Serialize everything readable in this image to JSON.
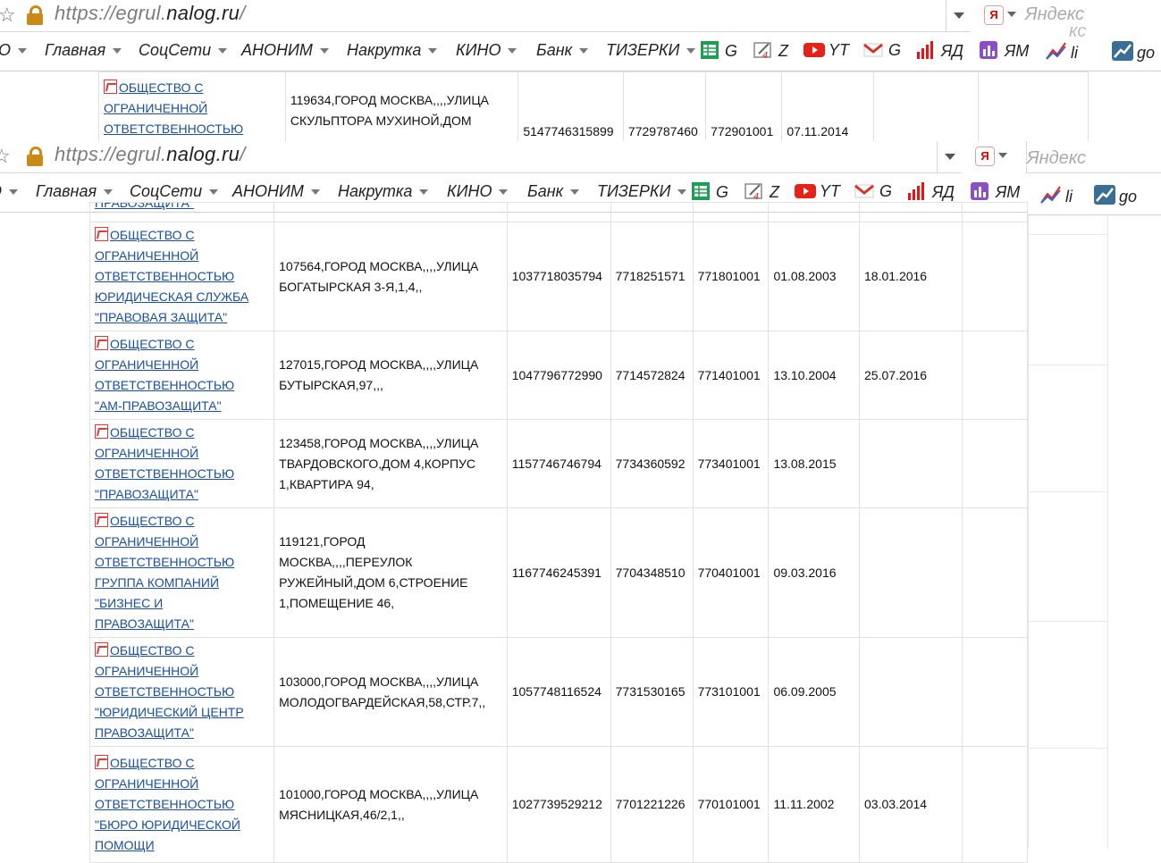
{
  "browser": {
    "url_prefix": "https://egrul.",
    "url_domain": "nalog.ru",
    "url_suffix": "/",
    "search_placeholder": "Яндекс",
    "search_partial_text": "кс"
  },
  "bookmarks": [
    {
      "label": "О",
      "dropdown": true
    },
    {
      "label": "Главная",
      "dropdown": true
    },
    {
      "label": "СоцСети",
      "dropdown": true
    },
    {
      "label": "АНОНИМ",
      "dropdown": true
    },
    {
      "label": "Накрутка",
      "dropdown": true
    },
    {
      "label": "КИНО",
      "dropdown": true
    },
    {
      "label": "Банк",
      "dropdown": true
    },
    {
      "label": "ТИЗЕРКИ",
      "dropdown": true
    },
    {
      "label": "G",
      "icon": "google-sheets-icon"
    },
    {
      "label": "Z",
      "icon": "edit-icon"
    },
    {
      "label": "YT",
      "icon": "youtube-icon"
    },
    {
      "label": "G",
      "icon": "gmail-icon"
    },
    {
      "label": "ЯД",
      "icon": "bar-chart-icon"
    },
    {
      "label": "ЯМ",
      "icon": "metrika-icon"
    },
    {
      "label": "li",
      "icon": "liveinternet-icon"
    },
    {
      "label": "go",
      "icon": "analytics-icon"
    }
  ],
  "top_row": {
    "name": [
      "ОБЩЕСТВО С",
      "ОГРАНИЧЕННОЙ",
      "ОТВЕТСТВЕННОСТЬЮ"
    ],
    "address": [
      "119634,ГОРОД МОСКВА,,,,УЛИЦА",
      "СКУЛЬПТОРА МУХИНОЙ,ДОМ"
    ],
    "ogrn": "5147746315899",
    "inn": "7729787460",
    "kpp": "772901001",
    "date_reg": "07.11.2014",
    "date_end": ""
  },
  "partial_prev_name": "ПРАВОЗАЩИТА\"",
  "rows": [
    {
      "name": [
        "ОБЩЕСТВО С",
        "ОГРАНИЧЕННОЙ",
        "ОТВЕТСТВЕННОСТЬЮ",
        "ЮРИДИЧЕСКАЯ СЛУЖБА",
        "\"ПРАВОВАЯ ЗАЩИТА\""
      ],
      "address": [
        "107564,ГОРОД МОСКВА,,,,УЛИЦА",
        "БОГАТЫРСКАЯ 3-Я,1,4,,"
      ],
      "ogrn": "1037718035794",
      "inn": "7718251571",
      "kpp": "771801001",
      "date_reg": "01.08.2003",
      "date_end": "18.01.2016"
    },
    {
      "name": [
        "ОБЩЕСТВО С",
        "ОГРАНИЧЕННОЙ",
        "ОТВЕТСТВЕННОСТЬЮ",
        "\"АМ-ПРАВОЗАЩИТА\""
      ],
      "address": [
        "127015,ГОРОД МОСКВА,,,,УЛИЦА",
        "БУТЫРСКАЯ,97,,,"
      ],
      "ogrn": "1047796772990",
      "inn": "7714572824",
      "kpp": "771401001",
      "date_reg": "13.10.2004",
      "date_end": "25.07.2016"
    },
    {
      "name": [
        "ОБЩЕСТВО С",
        "ОГРАНИЧЕННОЙ",
        "ОТВЕТСТВЕННОСТЬЮ",
        "\"ПРАВОЗАЩИТА\""
      ],
      "address": [
        "123458,ГОРОД МОСКВА,,,,УЛИЦА",
        "ТВАРДОВСКОГО,ДОМ 4,КОРПУС",
        "1,КВАРТИРА 94,"
      ],
      "ogrn": "1157746746794",
      "inn": "7734360592",
      "kpp": "773401001",
      "date_reg": "13.08.2015",
      "date_end": ""
    },
    {
      "name": [
        "ОБЩЕСТВО С",
        "ОГРАНИЧЕННОЙ",
        "ОТВЕТСТВЕННОСТЬЮ",
        "ГРУППА КОМПАНИЙ",
        "\"БИЗНЕС И",
        "ПРАВОЗАЩИТА\""
      ],
      "address": [
        "119121,ГОРОД",
        "МОСКВА,,,,ПЕРЕУЛОК",
        "РУЖЕЙНЫЙ,ДОМ 6,СТРОЕНИЕ",
        "1,ПОМЕЩЕНИЕ 46,"
      ],
      "ogrn": "1167746245391",
      "inn": "7704348510",
      "kpp": "770401001",
      "date_reg": "09.03.2016",
      "date_end": ""
    },
    {
      "name": [
        "ОБЩЕСТВО С",
        "ОГРАНИЧЕННОЙ",
        "ОТВЕТСТВЕННОСТЬЮ",
        "\"ЮРИДИЧЕСКИЙ ЦЕНТР",
        "ПРАВОЗАЩИТА\""
      ],
      "address": [
        "103000,ГОРОД МОСКВА,,,,УЛИЦА",
        "МОЛОДОГВАРДЕЙСКАЯ,58,СТР.7,,"
      ],
      "ogrn": "1057748116524",
      "inn": "7731530165",
      "kpp": "773101001",
      "date_reg": "06.09.2005",
      "date_end": ""
    },
    {
      "name": [
        "ОБЩЕСТВО С",
        "ОГРАНИЧЕННОЙ",
        "ОТВЕТСТВЕННОСТЬЮ",
        "\"БЮРО ЮРИДИЧЕСКОЙ",
        "ПОМОЩИ"
      ],
      "address": [
        "101000,ГОРОД МОСКВА,,,,УЛИЦА",
        "МЯСНИЦКАЯ,46/2,1,,"
      ],
      "ogrn": "1027739529212",
      "inn": "7701221226",
      "kpp": "770101001",
      "date_reg": "11.11.2002",
      "date_end": "03.03.2014"
    }
  ]
}
